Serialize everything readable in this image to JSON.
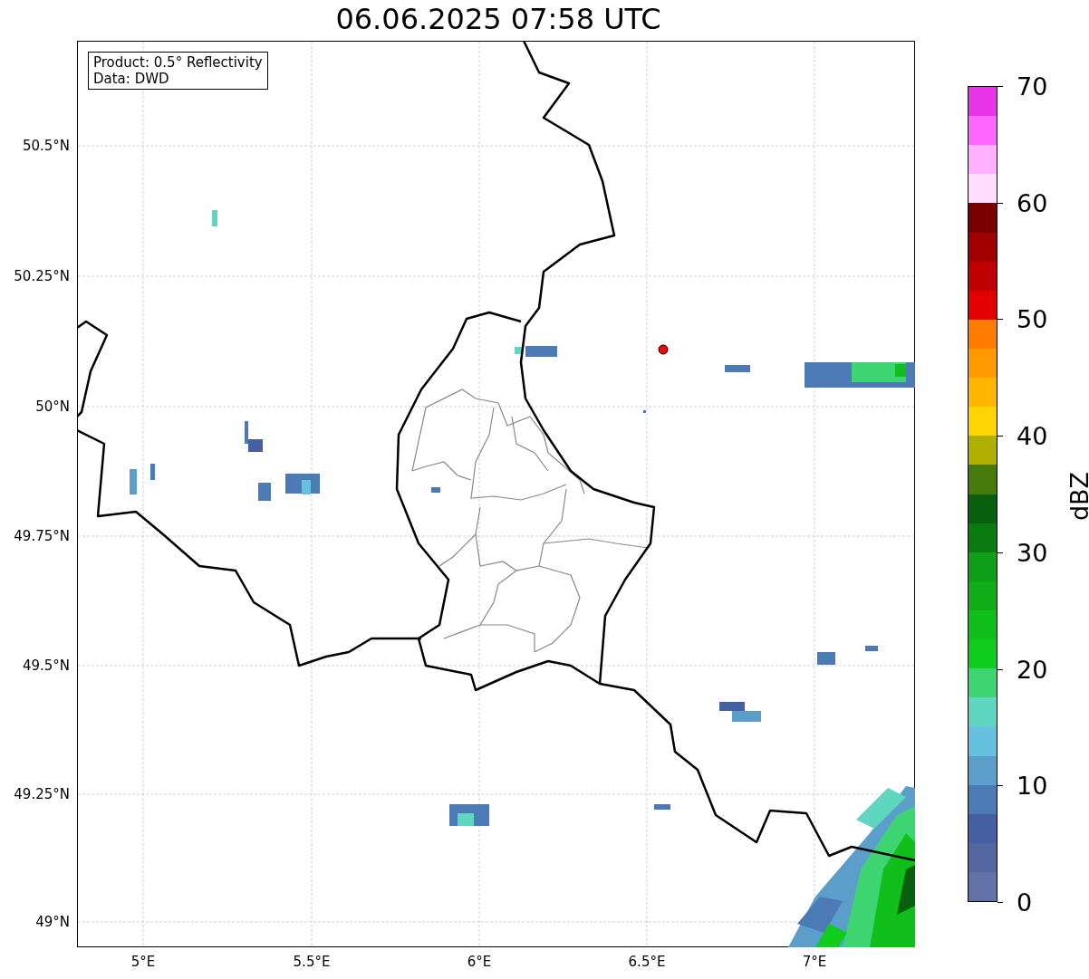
{
  "title": "06.06.2025 07:58 UTC",
  "legend": [
    "Product: 0.5° Reflectivity",
    "Data: DWD"
  ],
  "lat_ticks": [
    "50.5°N",
    "50.25°N",
    "50°N",
    "49.75°N",
    "49.5°N",
    "49.25°N",
    "49°N"
  ],
  "lon_ticks": [
    "5°E",
    "5.5°E",
    "6°E",
    "6.5°E",
    "7°E"
  ],
  "colorbar": {
    "label": "dBZ",
    "ticks": [
      "70",
      "60",
      "50",
      "40",
      "30",
      "20",
      "10",
      "0"
    ],
    "bins": [
      {
        "color": "#e935e9"
      },
      {
        "color": "#ff66ff"
      },
      {
        "color": "#ffb0ff"
      },
      {
        "color": "#ffdcff"
      },
      {
        "color": "#7a0000"
      },
      {
        "color": "#a00000"
      },
      {
        "color": "#c00000"
      },
      {
        "color": "#e30000"
      },
      {
        "color": "#ff7c00"
      },
      {
        "color": "#ff9900"
      },
      {
        "color": "#ffb600"
      },
      {
        "color": "#ffd500"
      },
      {
        "color": "#b0b000"
      },
      {
        "color": "#467a0a"
      },
      {
        "color": "#085f0d"
      },
      {
        "color": "#0b7a10"
      },
      {
        "color": "#0f9e17"
      },
      {
        "color": "#10ad18"
      },
      {
        "color": "#10bf1a"
      },
      {
        "color": "#10cc1c"
      },
      {
        "color": "#3dd571"
      },
      {
        "color": "#5fd6c0"
      },
      {
        "color": "#66c1de"
      },
      {
        "color": "#5b9ec9"
      },
      {
        "color": "#4c7ab4"
      },
      {
        "color": "#4460a3"
      },
      {
        "color": "#5467a0"
      },
      {
        "color": "#6272a8"
      }
    ]
  }
}
